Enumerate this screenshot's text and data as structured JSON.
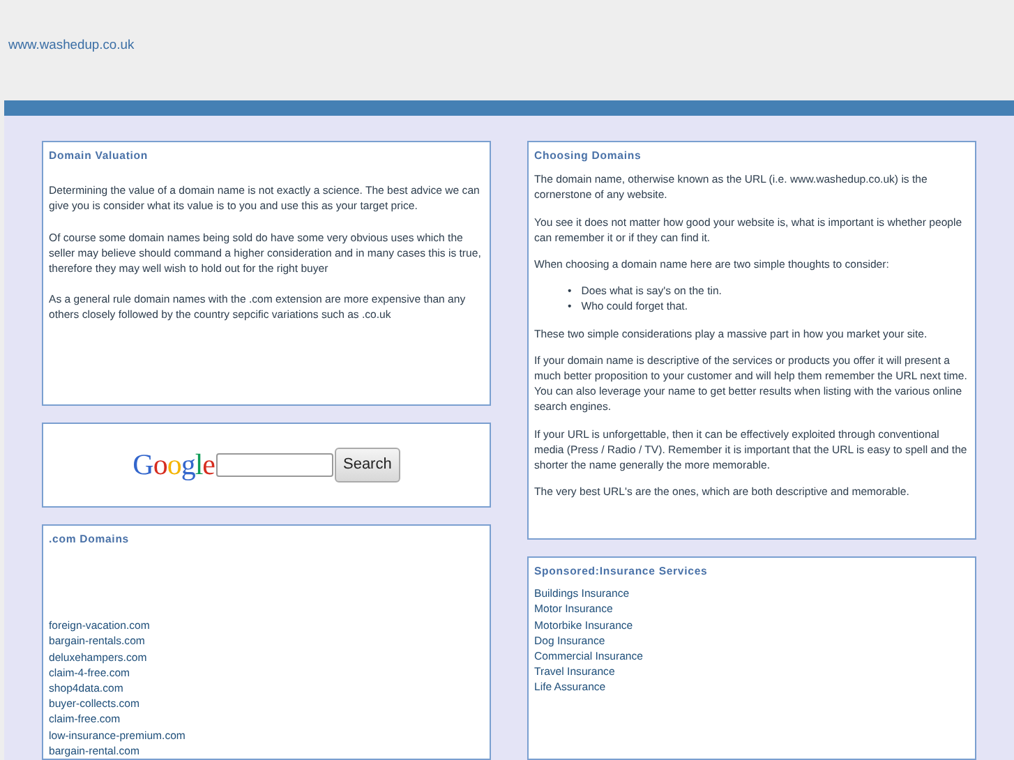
{
  "site_link": "www.washedup.co.uk",
  "valuation": {
    "title": "Domain Valuation",
    "paragraphs": [
      "Determining the value of a domain name is not exactly a science. The best advice we can give you is consider what its value is to you and use this as your target price.",
      "Of course some domain names being sold do have some very obvious uses which the seller may believe should command a higher consideration and in many cases this is true, therefore they may well wish to hold out for the right buyer",
      "As a general rule domain names with the .com extension are more expensive than any others closely followed by the country sepcific variations such as .co.uk"
    ]
  },
  "search": {
    "logo": "Google",
    "button": "Search"
  },
  "com_domains": {
    "title": ".com Domains",
    "links": [
      "foreign-vacation.com",
      "bargain-rentals.com",
      "deluxehampers.com",
      "claim-4-free.com",
      "shop4data.com",
      "buyer-collects.com",
      "claim-free.com",
      "low-insurance-premium.com",
      "bargain-rental.com"
    ]
  },
  "choosing": {
    "title": "Choosing Domains",
    "blocks": [
      {
        "kind": "para",
        "text": "The domain name, otherwise known as the URL (i.e. www.washedup.co.uk) is the cornerstone of any website."
      },
      {
        "kind": "para",
        "text": "You see it does not matter how good your website is, what is important is whether people can remember it or if they can find it."
      },
      {
        "kind": "para",
        "text": "When choosing a domain name here are two simple thoughts to consider:"
      },
      {
        "kind": "list",
        "items": [
          {
            "bullet": "•",
            "text": "Does what is say's on the tin."
          },
          {
            "bullet": "•",
            "text": "Who could forget that."
          }
        ]
      },
      {
        "kind": "para",
        "text": "These two simple considerations play a massive part in how you market your site."
      },
      {
        "kind": "para",
        "text": "If your domain name is descriptive of the services or products you offer it will present a much better proposition to your customer and will help them remember the URL next time. You can also leverage your name to get better results when listing with the various online search engines."
      },
      {
        "kind": "para",
        "text": "If your URL is unforgettable, then it can be effectively exploited through conventional media (Press / Radio / TV). Remember it is important that the URL is easy to spell and the shorter the name generally the more memorable."
      },
      {
        "kind": "para",
        "text": "The very best URL's are the ones, which are both descriptive and memorable."
      }
    ]
  },
  "sponsored": {
    "title": "Sponsored:Insurance Services",
    "links": [
      "Buildings Insurance",
      "Motor Insurance",
      "Motorbike Insurance",
      "Dog Insurance",
      "Commercial Insurance",
      "Travel Insurance",
      "Life Assurance"
    ]
  }
}
